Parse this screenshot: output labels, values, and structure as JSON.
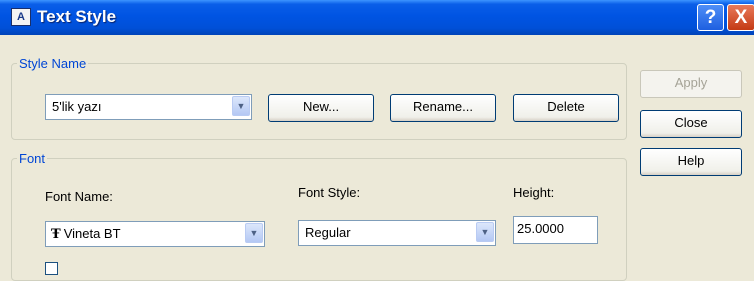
{
  "window": {
    "title": "Text Style",
    "help_glyph": "?",
    "close_glyph": "X",
    "app_icon": "text-style-icon"
  },
  "style_group": {
    "legend": "Style Name",
    "selected": "5'lik yazı",
    "buttons": {
      "new": "New...",
      "rename": "Rename...",
      "delete": "Delete"
    }
  },
  "side_buttons": {
    "apply": "Apply",
    "close": "Close",
    "help": "Help"
  },
  "font_group": {
    "legend": "Font",
    "font_name_label": "Font Name:",
    "font_name_value": "Vineta BT",
    "font_name_icon": "truetype-font-icon",
    "font_style_label": "Font Style:",
    "font_style_value": "Regular",
    "height_label": "Height:",
    "height_value": "25.0000"
  },
  "colors": {
    "titlebar": "#0054e3",
    "legend_text": "#0046d5",
    "dialog_bg": "#ece9d8"
  }
}
